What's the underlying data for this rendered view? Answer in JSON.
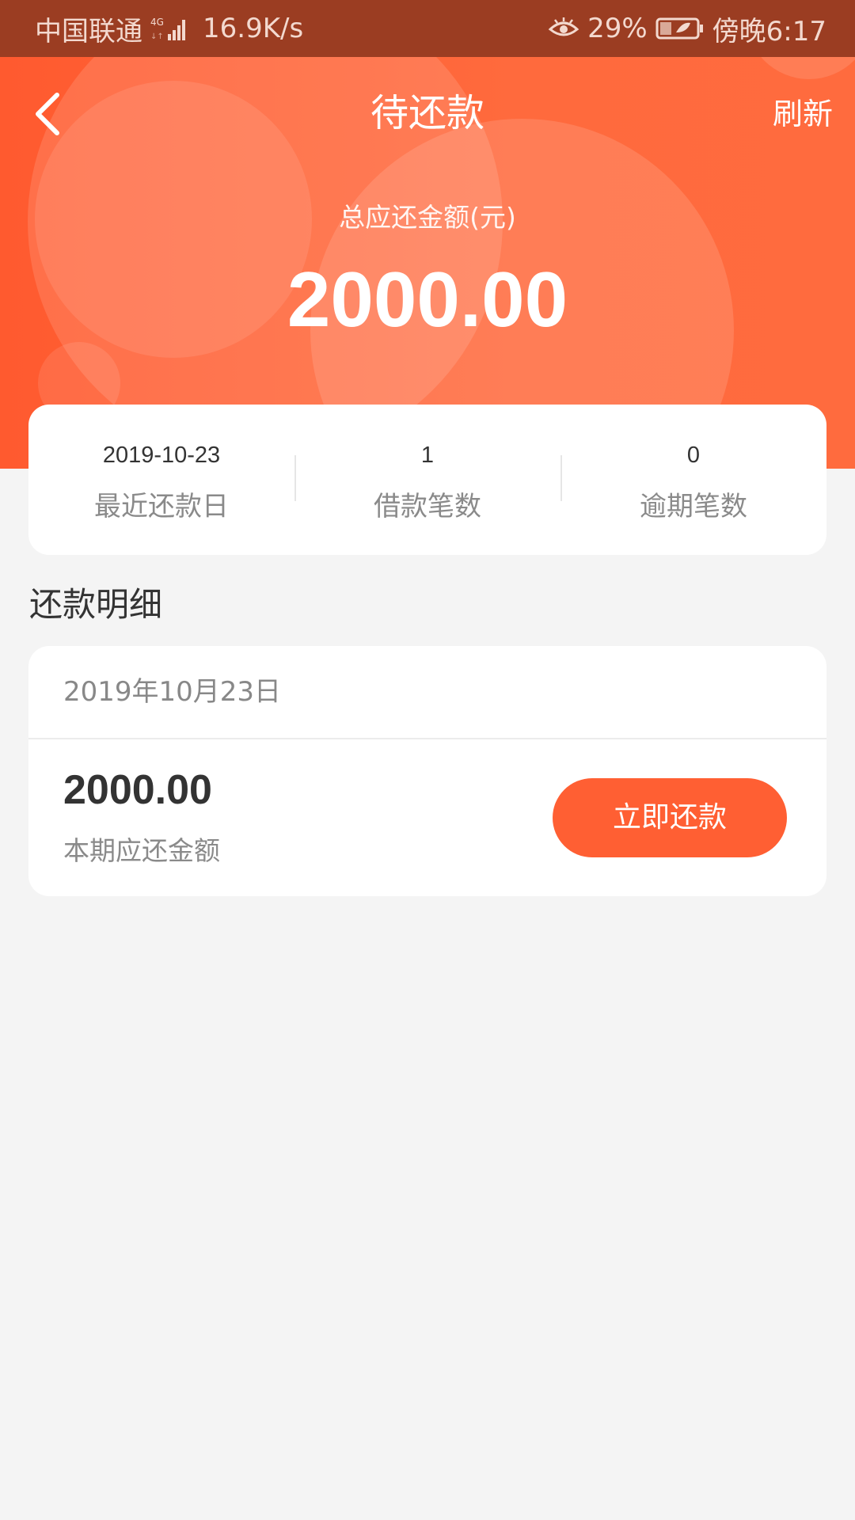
{
  "status_bar": {
    "carrier": "中国联通",
    "network_type": "4G",
    "speed": "16.9K/s",
    "battery": "29%",
    "time": "傍晚6:17"
  },
  "nav": {
    "title": "待还款",
    "refresh_label": "刷新"
  },
  "summary": {
    "total_label": "总应还金额(元)",
    "total_amount": "2000.00",
    "items": [
      {
        "value": "2019-10-23",
        "label": "最近还款日"
      },
      {
        "value": "1",
        "label": "借款笔数"
      },
      {
        "value": "0",
        "label": "逾期笔数"
      }
    ]
  },
  "details": {
    "section_title": "还款明细",
    "date": "2019年10月23日",
    "amount": "2000.00",
    "amount_label": "本期应还金额",
    "button_label": "立即还款"
  },
  "colors": {
    "accent": "#ff5f33",
    "background": "#f4f4f4"
  }
}
